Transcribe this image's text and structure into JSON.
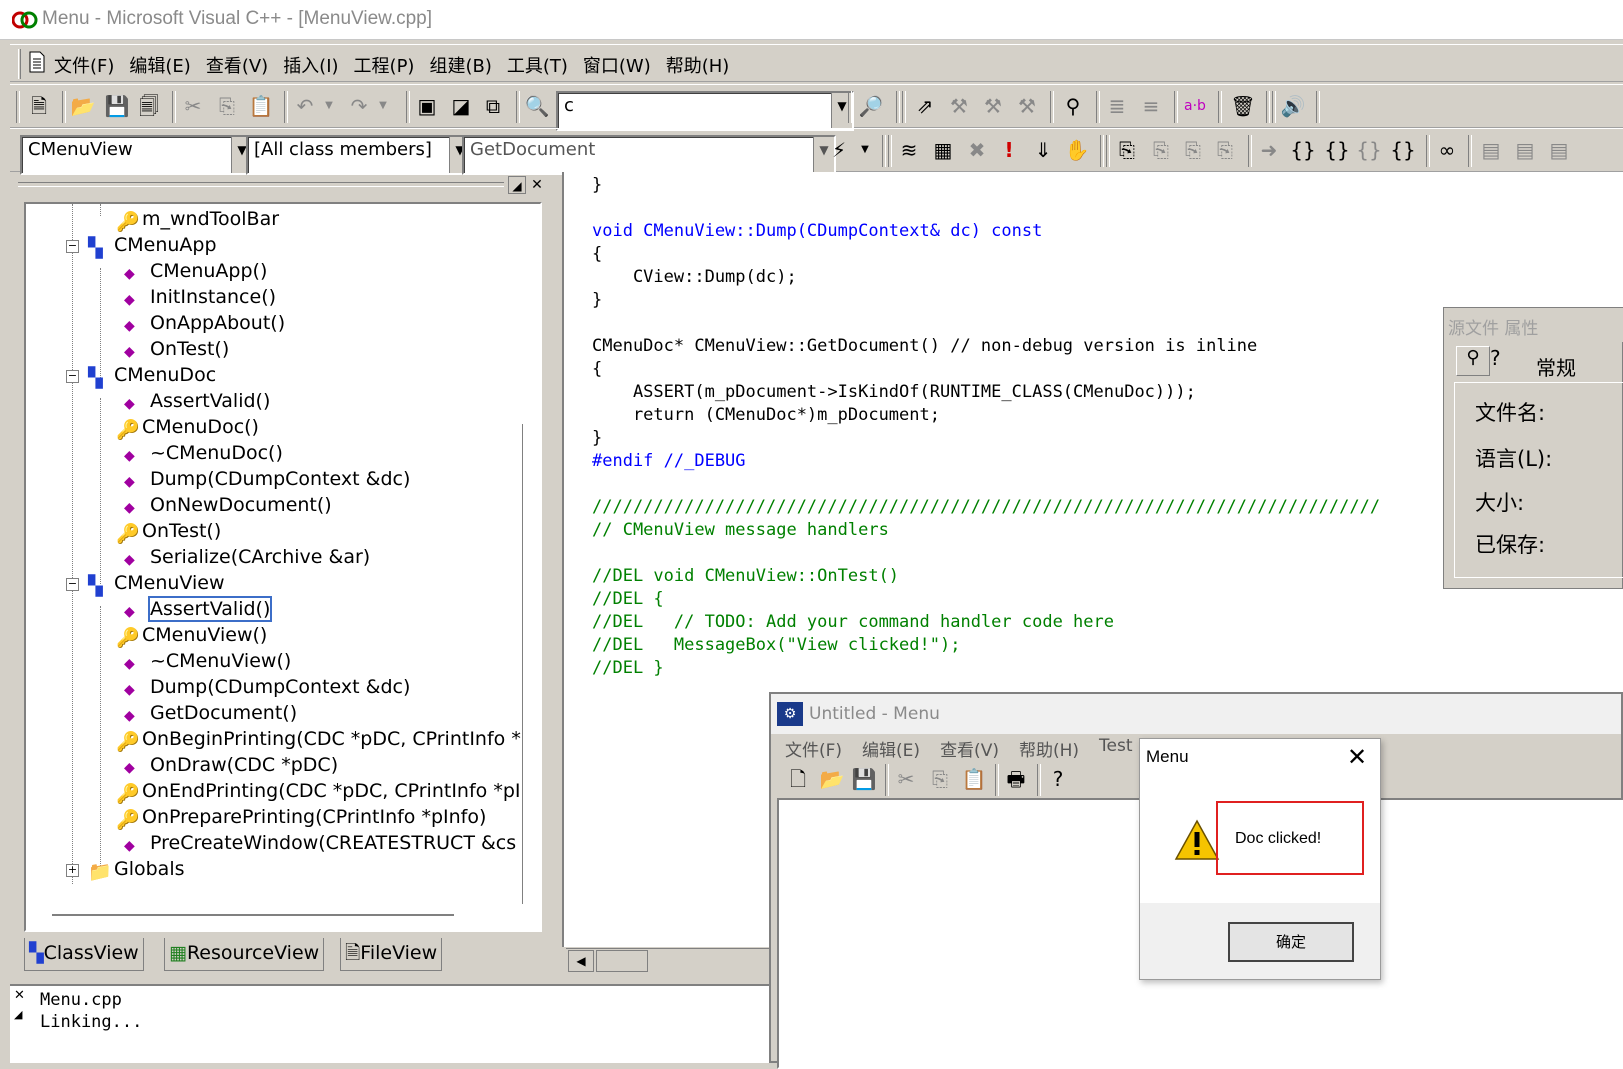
{
  "window": {
    "title": "Menu - Microsoft Visual C++ - [MenuView.cpp]"
  },
  "menubar": {
    "items": [
      "文件(F)",
      "编辑(E)",
      "查看(V)",
      "插入(I)",
      "工程(P)",
      "组建(B)",
      "工具(T)",
      "窗口(W)",
      "帮助(H)"
    ]
  },
  "toolbar": {
    "find_combo_value": "c"
  },
  "wizardbar": {
    "class_combo": "CMenuView",
    "filter_combo": "[All class members]",
    "member_combo": "GetDocument"
  },
  "classview": {
    "items": [
      "m_wndToolBar",
      "CMenuApp",
      "CMenuApp()",
      "InitInstance()",
      "OnAppAbout()",
      "OnTest()",
      "CMenuDoc",
      "AssertValid()",
      "CMenuDoc()",
      "~CMenuDoc()",
      "Dump(CDumpContext &dc)",
      "OnNewDocument()",
      "OnTest()",
      "Serialize(CArchive &ar)",
      "CMenuView",
      "AssertValid()",
      "CMenuView()",
      "~CMenuView()",
      "Dump(CDumpContext &dc)",
      "GetDocument()",
      "OnBeginPrinting(CDC *pDC, CPrintInfo *",
      "OnDraw(CDC *pDC)",
      "OnEndPrinting(CDC *pDC, CPrintInfo *pI",
      "OnPreparePrinting(CPrintInfo *pInfo)",
      "PreCreateWindow(CREATESTRUCT &cs",
      "Globals"
    ],
    "tabs": [
      "ClassView",
      "ResourceView",
      "FileView"
    ]
  },
  "editor": {
    "lines": [
      "}",
      "",
      "void CMenuView::Dump(CDumpContext& dc) const",
      "{",
      "    CView::Dump(dc);",
      "}",
      "",
      "CMenuDoc* CMenuView::GetDocument() // non-debug version is inline",
      "{",
      "    ASSERT(m_pDocument->IsKindOf(RUNTIME_CLASS(CMenuDoc)));",
      "    return (CMenuDoc*)m_pDocument;",
      "}",
      "#endif //_DEBUG",
      "",
      "/////////////////////////////////////////////////////////////////////////////",
      "// CMenuView message handlers",
      "",
      "//DEL void CMenuView::OnTest()",
      "//DEL {",
      "//DEL   // TODO: Add your command handler code here",
      "//DEL   MessageBox(\"View clicked!\");",
      "//DEL }"
    ]
  },
  "output": {
    "lines": [
      "Menu.cpp",
      "Linking..."
    ]
  },
  "properties": {
    "title": "源文件 属性",
    "tab": "常规",
    "labels": [
      "文件名:",
      "语言(L):",
      "大小:",
      "已保存:"
    ]
  },
  "appwindow": {
    "title": "Untitled - Menu",
    "menu": [
      "文件(F)",
      "编辑(E)",
      "查看(V)",
      "帮助(H)",
      "Test"
    ]
  },
  "messagebox": {
    "title": "Menu",
    "message": "Doc clicked!",
    "ok_label": "确定"
  }
}
